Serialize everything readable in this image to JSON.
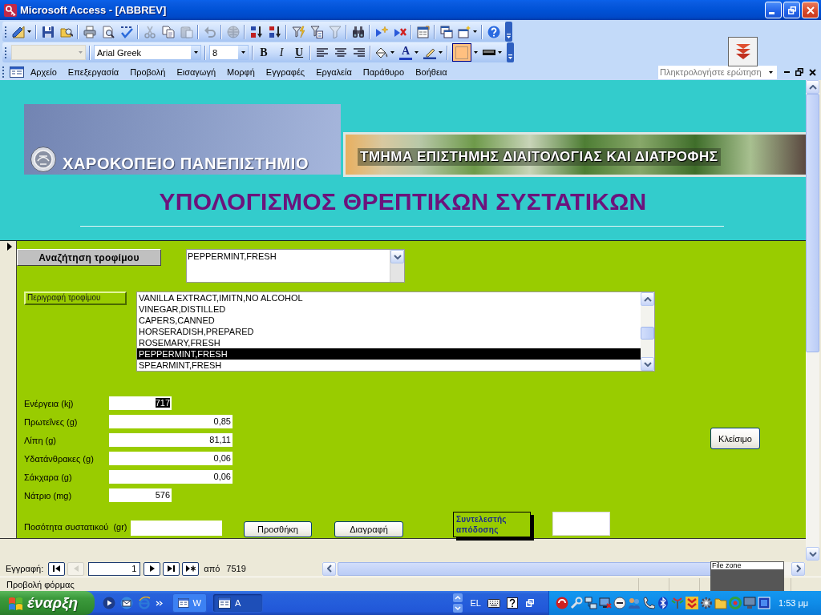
{
  "window": {
    "title": "Microsoft Access - [ABBREV]"
  },
  "standard_toolbar": {
    "buttons": [
      {
        "disabled": false
      },
      {
        "disabled": false
      },
      {
        "disabled": false
      },
      {
        "disabled": false
      },
      {
        "disabled": false
      },
      {
        "disabled": false
      },
      {
        "disabled": true
      },
      {
        "disabled": false
      },
      {
        "disabled": true
      },
      {
        "disabled": true
      },
      {
        "disabled": true
      },
      {
        "disabled": false
      },
      {
        "disabled": false
      },
      {
        "disabled": false
      },
      {
        "disabled": false
      },
      {
        "disabled": true
      },
      {
        "disabled": false
      },
      {
        "disabled": false
      },
      {
        "disabled": false
      },
      {
        "disabled": false
      },
      {
        "disabled": false
      },
      {
        "disabled": false
      },
      {
        "disabled": false
      }
    ]
  },
  "formatting_toolbar": {
    "object_box": {
      "disabled": true
    },
    "font": "Arial Greek",
    "font_size": "8",
    "style_buttons": [
      {
        "label": "B"
      },
      {
        "label": "I"
      },
      {
        "label": "U"
      }
    ],
    "font_color_button": {
      "label": "A"
    },
    "border_button": {
      "checked": true
    }
  },
  "menu_bar": {
    "items": [
      "Αρχείο",
      "Επεξεργασία",
      "Προβολή",
      "Εισαγωγή",
      "Μορφή",
      "Εγγραφές",
      "Εργαλεία",
      "Παράθυρο",
      "Βοήθεια"
    ],
    "question_box": {
      "placeholder": "Πληκτρολογήστε ερώτηση"
    }
  },
  "form_header": {
    "university": "ΧΑΡΟΚΟΠΕΙΟ ΠΑΝΕΠΙΣΤΗΜΙΟ",
    "department": "ΤΜΗΜΑ ΕΠΙΣΤΗΜΗΣ ΔΙΑΙΤΟΛΟΓΙΑΣ ΚΑΙ ΔΙΑΤΡΟΦΗΣ",
    "title": "ΥΠΟΛΟΓΙΣΜΟΣ ΘΡΕΠΤΙΚΩΝ ΣΥΣΤΑΤΙΚΩΝ"
  },
  "detail": {
    "search_button": "Αναζήτηση τροφίμου",
    "search_combo": {
      "value": "PEPPERMINT,FRESH"
    },
    "description_label": "Περιγραφή τροφίμου",
    "food_list": [
      {
        "text": "VANILLA EXTRACT,IMITN,NO ALCOHOL",
        "selected": false
      },
      {
        "text": "VINEGAR,DISTILLED",
        "selected": false
      },
      {
        "text": "CAPERS,CANNED",
        "selected": false
      },
      {
        "text": "HORSERADISH,PREPARED",
        "selected": false
      },
      {
        "text": "ROSEMARY,FRESH",
        "selected": false
      },
      {
        "text": "PEPPERMINT,FRESH",
        "selected": true
      },
      {
        "text": "SPEARMINT,FRESH",
        "selected": false
      }
    ],
    "nutrients": [
      {
        "label": "Ενέργεια (kj)",
        "value": "717",
        "kind": "short",
        "text_selected": true
      },
      {
        "label": "Πρωτεΐνες (g)",
        "value": "0,85",
        "kind": "long",
        "text_selected": false
      },
      {
        "label": "Λίπη (g)",
        "value": "81,11",
        "kind": "long",
        "text_selected": false
      },
      {
        "label": "Υδατάνθρακες (g)",
        "value": "0,06",
        "kind": "long",
        "text_selected": false
      },
      {
        "label": "Σάκχαρα (g)",
        "value": "0,06",
        "kind": "long",
        "text_selected": false
      },
      {
        "label": "Νάτριο (mg)",
        "value": "576",
        "kind": "short",
        "text_selected": false
      }
    ],
    "close_button": "Κλείσιμο",
    "quantity": {
      "label": "Ποσότητα συστατικού  (gr)"
    },
    "buttons": [
      "Προσθήκη",
      "Διαγραφή"
    ],
    "yield": {
      "label": "Συντελεστής απόδοσης"
    }
  },
  "record_navigator": {
    "label": "Εγγραφή:",
    "buttons": [
      {
        "disabled": false
      },
      {
        "disabled": true
      },
      {
        "disabled": false
      },
      {
        "disabled": false
      },
      {
        "disabled": false
      }
    ],
    "record": "1",
    "of_label": "από",
    "total": "7519"
  },
  "status_bar": {
    "text": "Προβολή φόρμας"
  },
  "overlay": {
    "label": "File zone"
  },
  "taskbar": {
    "start": "έναρξη",
    "tasks": [
      {
        "label": "W",
        "selected": false
      },
      {
        "label": "A",
        "selected": true
      }
    ],
    "language": "EL",
    "clock": "1:53 μμ"
  }
}
